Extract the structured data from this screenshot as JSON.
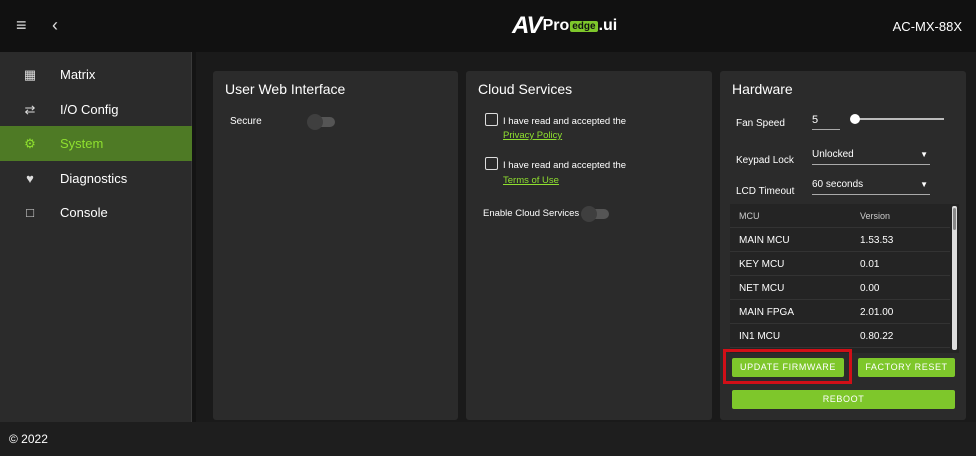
{
  "header": {
    "logo_av": "AV",
    "logo_pro": "Pro",
    "logo_edge": "edge",
    "logo_ui": ".ui",
    "model": "AC-MX-88X"
  },
  "sidebar": {
    "items": [
      {
        "label": "Matrix",
        "icon": "grid-icon"
      },
      {
        "label": "I/O Config",
        "icon": "swap-icon"
      },
      {
        "label": "System",
        "icon": "gear-icon",
        "active": true
      },
      {
        "label": "Diagnostics",
        "icon": "heartbeat-icon"
      },
      {
        "label": "Console",
        "icon": "terminal-icon"
      }
    ]
  },
  "panels": {
    "web": {
      "title": "User Web Interface",
      "secure_label": "Secure"
    },
    "cloud": {
      "title": "Cloud Services",
      "privacy_text": "I have read and accepted the",
      "privacy_link": "Privacy Policy",
      "terms_text": "I have read and accepted the",
      "terms_link": "Terms of Use",
      "enable_label": "Enable Cloud Services"
    },
    "hardware": {
      "title": "Hardware",
      "fan_label": "Fan Speed",
      "fan_value": "5",
      "keypad_label": "Keypad Lock",
      "keypad_value": "Unlocked",
      "lcd_label": "LCD Timeout",
      "lcd_value": "60 seconds",
      "table_headers": [
        "MCU",
        "Version"
      ],
      "table_rows": [
        [
          "MAIN MCU",
          "1.53.53"
        ],
        [
          "KEY MCU",
          "0.01"
        ],
        [
          "NET MCU",
          "0.00"
        ],
        [
          "MAIN FPGA",
          "2.01.00"
        ],
        [
          "IN1 MCU",
          "0.80.22"
        ]
      ],
      "update_button": "UPDATE FIRMWARE",
      "factory_button": "FACTORY RESET",
      "reboot_button": "REBOOT"
    }
  },
  "footer": {
    "copyright": "© 2022"
  },
  "colors": {
    "accent": "#7ec72b",
    "active_nav": "#4e7a25",
    "highlight": "#d10f17"
  }
}
